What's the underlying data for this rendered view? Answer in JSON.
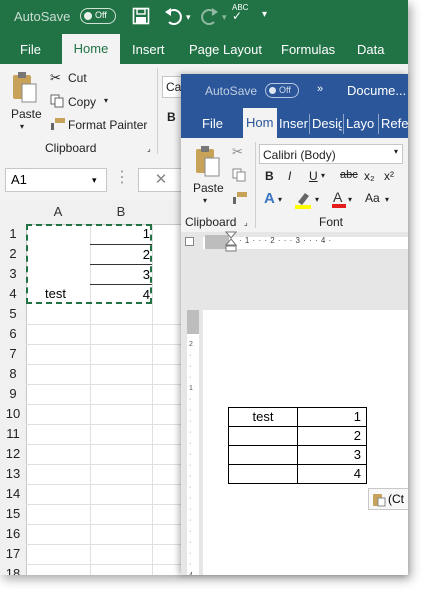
{
  "excel": {
    "autosave_label": "AutoSave",
    "autosave_state": "Off",
    "tabs": [
      "File",
      "Home",
      "Insert",
      "Page Layout",
      "Formulas",
      "Data"
    ],
    "clipboard": {
      "paste": "Paste",
      "cut": "Cut",
      "copy": "Copy",
      "format_painter": "Format Painter",
      "group": "Clipboard"
    },
    "font_partial": "Cali",
    "bold": "B",
    "namebox": "A1",
    "columns": [
      "A",
      "B"
    ],
    "rows": [
      "1",
      "2",
      "3",
      "4",
      "5",
      "6",
      "7",
      "8",
      "9",
      "10",
      "11",
      "12",
      "13",
      "14",
      "15",
      "16",
      "17",
      "18"
    ],
    "cells": {
      "a4": "test",
      "b": [
        "1",
        "2",
        "3",
        "4"
      ]
    }
  },
  "word": {
    "autosave_label": "AutoSave",
    "autosave_state": "Off",
    "doc_title": "Docume...",
    "tabs": [
      "File",
      "Hom",
      "Inser",
      "Desig",
      "Layo",
      "Refe"
    ],
    "clipboard": {
      "paste": "Paste",
      "group": "Clipboard"
    },
    "font_name": "Calibri (Body)",
    "font_group": "Font",
    "format_btns": [
      "B",
      "I",
      "U",
      "abc",
      "x₂",
      "x²"
    ],
    "aa_btn": "Aa",
    "table": [
      [
        "test",
        "1"
      ],
      [
        "",
        "2"
      ],
      [
        "",
        "3"
      ],
      [
        "",
        "4"
      ]
    ],
    "paste_options": "(Ct"
  }
}
